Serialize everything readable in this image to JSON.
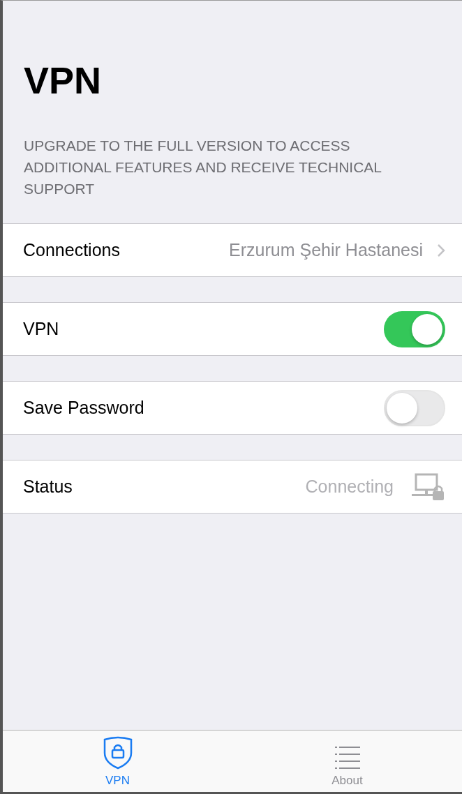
{
  "title": "VPN",
  "notice": "UPGRADE TO THE FULL VERSION TO ACCESS ADDITIONAL FEATURES AND RECEIVE TECHNICAL SUPPORT",
  "rows": [
    {
      "kind": "link",
      "label": "Connections",
      "value": "Erzurum Şehir Hastanesi"
    },
    {
      "kind": "toggle",
      "label": "VPN",
      "on": true
    },
    {
      "kind": "toggle",
      "label": "Save Password",
      "on": false
    },
    {
      "kind": "status",
      "label": "Status",
      "value": "Connecting"
    }
  ],
  "tabs": [
    {
      "kind": "shield",
      "label": "VPN",
      "selected": true
    },
    {
      "kind": "list",
      "label": "About",
      "selected": false
    }
  ]
}
